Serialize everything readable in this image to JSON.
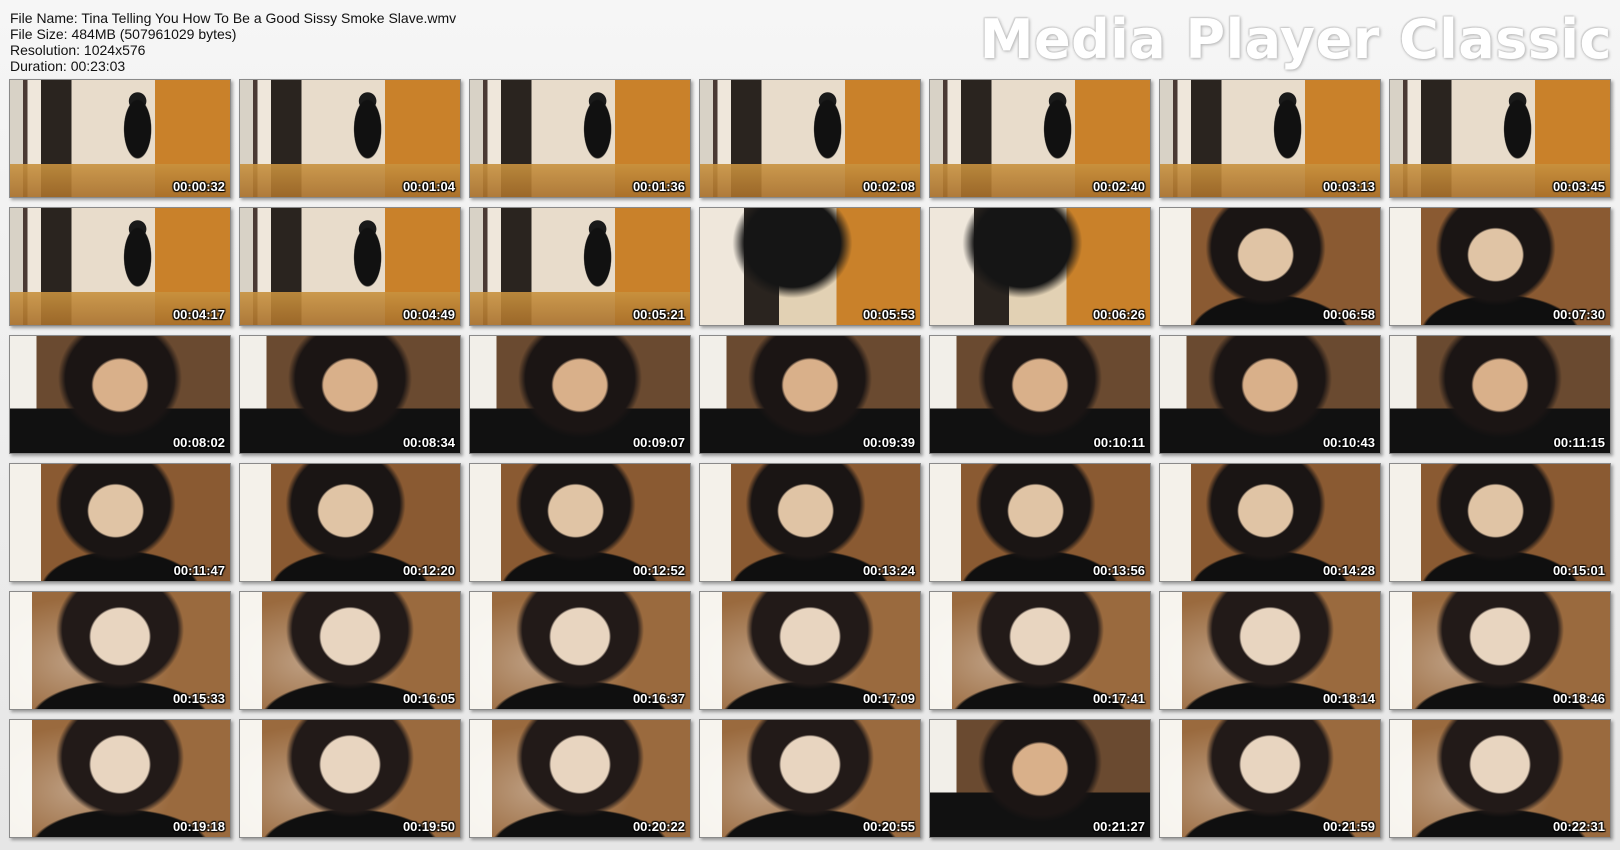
{
  "info": {
    "file_name": "File Name: Tina Telling You How To Be a Good Sissy Smoke Slave.wmv",
    "file_size": "File Size: 484MB (507961029 bytes)",
    "resolution": "Resolution: 1024x576",
    "duration": "Duration: 00:23:03"
  },
  "brand": "Media Player Classic",
  "thumbnails": [
    {
      "time": "00:00:32",
      "scene": "s1"
    },
    {
      "time": "00:01:04",
      "scene": "s1"
    },
    {
      "time": "00:01:36",
      "scene": "s1"
    },
    {
      "time": "00:02:08",
      "scene": "s1"
    },
    {
      "time": "00:02:40",
      "scene": "s1"
    },
    {
      "time": "00:03:13",
      "scene": "s1"
    },
    {
      "time": "00:03:45",
      "scene": "s1"
    },
    {
      "time": "00:04:17",
      "scene": "s1"
    },
    {
      "time": "00:04:49",
      "scene": "s1"
    },
    {
      "time": "00:05:21",
      "scene": "s1"
    },
    {
      "time": "00:05:53",
      "scene": "s2"
    },
    {
      "time": "00:06:26",
      "scene": "s2"
    },
    {
      "time": "00:06:58",
      "scene": "s4"
    },
    {
      "time": "00:07:30",
      "scene": "s4"
    },
    {
      "time": "00:08:02",
      "scene": "s3"
    },
    {
      "time": "00:08:34",
      "scene": "s3"
    },
    {
      "time": "00:09:07",
      "scene": "s3"
    },
    {
      "time": "00:09:39",
      "scene": "s3"
    },
    {
      "time": "00:10:11",
      "scene": "s3"
    },
    {
      "time": "00:10:43",
      "scene": "s3"
    },
    {
      "time": "00:11:15",
      "scene": "s3"
    },
    {
      "time": "00:11:47",
      "scene": "s4"
    },
    {
      "time": "00:12:20",
      "scene": "s4"
    },
    {
      "time": "00:12:52",
      "scene": "s4"
    },
    {
      "time": "00:13:24",
      "scene": "s4"
    },
    {
      "time": "00:13:56",
      "scene": "s4"
    },
    {
      "time": "00:14:28",
      "scene": "s4"
    },
    {
      "time": "00:15:01",
      "scene": "s4"
    },
    {
      "time": "00:15:33",
      "scene": "s5"
    },
    {
      "time": "00:16:05",
      "scene": "s5"
    },
    {
      "time": "00:16:37",
      "scene": "s5"
    },
    {
      "time": "00:17:09",
      "scene": "s5"
    },
    {
      "time": "00:17:41",
      "scene": "s5"
    },
    {
      "time": "00:18:14",
      "scene": "s5"
    },
    {
      "time": "00:18:46",
      "scene": "s5"
    },
    {
      "time": "00:19:18",
      "scene": "s5"
    },
    {
      "time": "00:19:50",
      "scene": "s5"
    },
    {
      "time": "00:20:22",
      "scene": "s5"
    },
    {
      "time": "00:20:55",
      "scene": "s5"
    },
    {
      "time": "00:21:27",
      "scene": "s3"
    },
    {
      "time": "00:21:59",
      "scene": "s5"
    },
    {
      "time": "00:22:31",
      "scene": "s5"
    }
  ]
}
